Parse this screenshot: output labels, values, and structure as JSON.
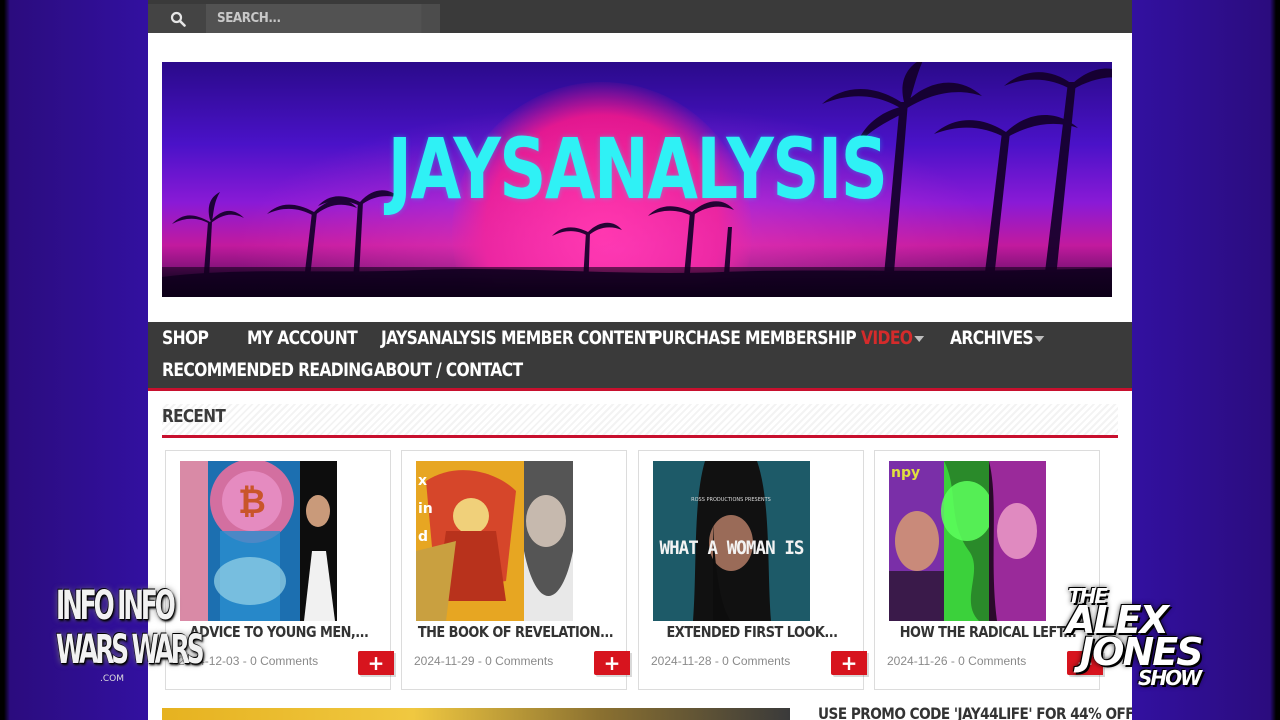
{
  "search": {
    "placeholder": "SEARCH..."
  },
  "banner": {
    "title": "JAYSANALYSIS"
  },
  "nav": {
    "items": [
      {
        "label": "SHOP"
      },
      {
        "label": "MY ACCOUNT"
      },
      {
        "label": "JAYSANALYSIS MEMBER CONTENT"
      },
      {
        "label": "PURCHASE MEMBERSHIP"
      },
      {
        "label": "VIDEO",
        "has_dropdown": true,
        "active": true
      },
      {
        "label": "ARCHIVES",
        "has_dropdown": true
      },
      {
        "label": "RECOMMENDED READING"
      },
      {
        "label": "ABOUT / CONTACT"
      }
    ]
  },
  "recent": {
    "title": "RECENT"
  },
  "cards": [
    {
      "title": "ADVICE TO YOUNG MEN,...",
      "date": "2024-12-03",
      "comments": "0 Comments"
    },
    {
      "title": "THE BOOK OF REVELATION...",
      "date": "2024-11-29",
      "comments": "0 Comments"
    },
    {
      "title": "EXTENDED FIRST LOOK...",
      "date": "2024-11-28",
      "comments": "0 Comments",
      "thumb_text": "WHAT A WOMAN IS"
    },
    {
      "title": "HOW THE RADICAL LEFT...",
      "date": "2024-11-26",
      "comments": "0 Comments"
    }
  ],
  "meta_separator": " - ",
  "plus_label": "+",
  "promo": {
    "text": "USE PROMO CODE 'JAY44LIFE' FOR 44% OFF"
  },
  "overlay": {
    "infowars_row1": "INFO INFO",
    "infowars_row2": "WARS WARS",
    "infowars_com": ".COM",
    "alex_the": "THE",
    "alex_alex": "ALEX",
    "alex_jones": "JONES",
    "alex_show": "SHOW"
  },
  "colors": {
    "accent_red": "#c8102e",
    "nav_bg": "#3a3a3a",
    "banner_title": "#2ff1f5"
  }
}
